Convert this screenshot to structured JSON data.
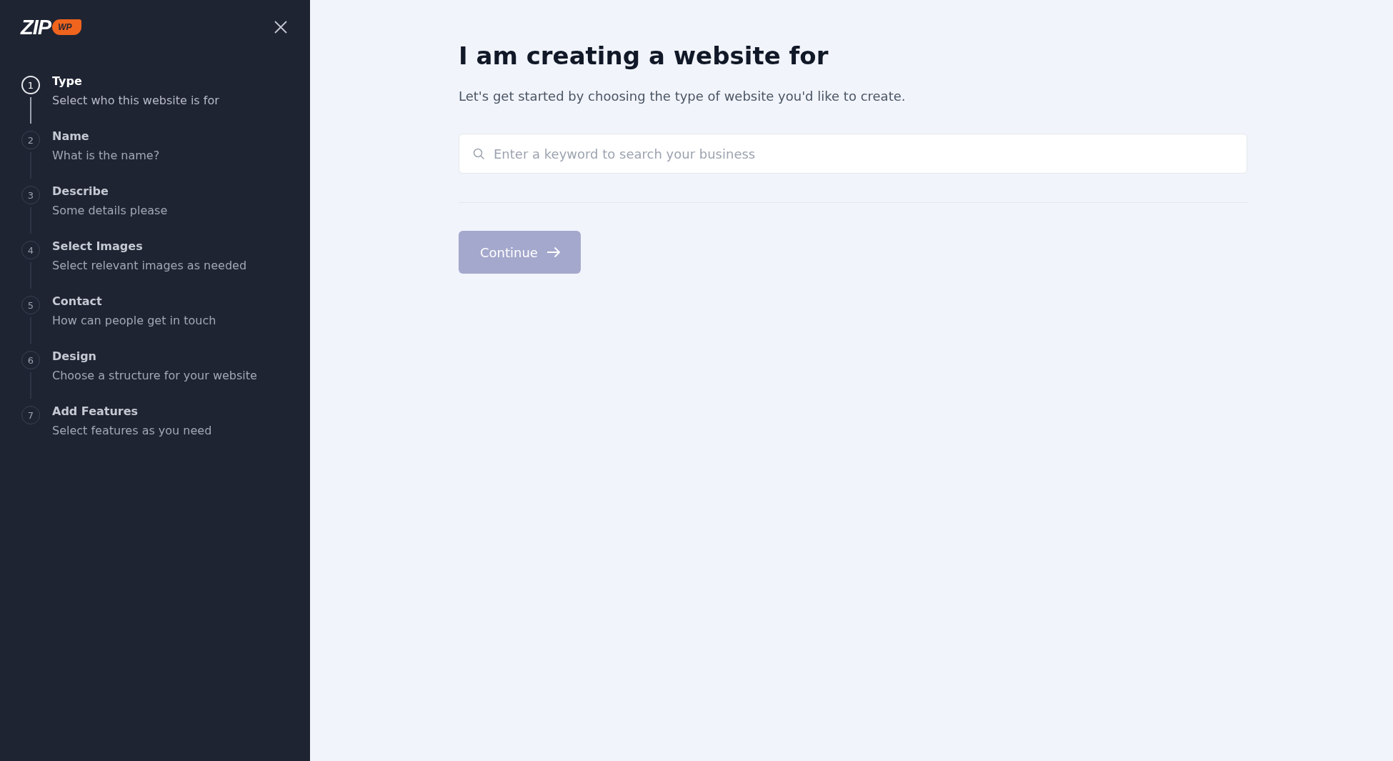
{
  "logo": {
    "text": "ZIP",
    "badge": "WP"
  },
  "steps": [
    {
      "number": "1",
      "title": "Type",
      "subtitle": "Select who this website is for",
      "active": true
    },
    {
      "number": "2",
      "title": "Name",
      "subtitle": "What is the name?",
      "active": false
    },
    {
      "number": "3",
      "title": "Describe",
      "subtitle": "Some details please",
      "active": false
    },
    {
      "number": "4",
      "title": "Select Images",
      "subtitle": "Select relevant images as needed",
      "active": false
    },
    {
      "number": "5",
      "title": "Contact",
      "subtitle": "How can people get in touch",
      "active": false
    },
    {
      "number": "6",
      "title": "Design",
      "subtitle": "Choose a structure for your website",
      "active": false
    },
    {
      "number": "7",
      "title": "Add Features",
      "subtitle": "Select features as you need",
      "active": false
    }
  ],
  "main": {
    "heading": "I am creating a website for",
    "description": "Let's get started by choosing the type of website you'd like to create.",
    "search": {
      "placeholder": "Enter a keyword to search your business"
    },
    "continue_button": {
      "label": "Continue",
      "disabled": true
    }
  }
}
